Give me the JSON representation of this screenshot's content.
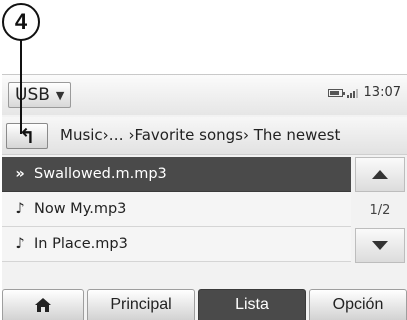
{
  "callout": {
    "label": "4"
  },
  "status_bar": {
    "source": "USB",
    "time": "13:07"
  },
  "breadcrumb": {
    "path": "Music›… ›Favorite songs› The newest"
  },
  "list": {
    "items": [
      {
        "icon": "speaker-icon",
        "label": "Swallowed.m.mp3",
        "active": true
      },
      {
        "icon": "music-note-icon",
        "label": "Now My.mp3",
        "active": false
      },
      {
        "icon": "music-note-icon",
        "label": "In Place.mp3",
        "active": false
      }
    ],
    "page_indicator": "1/2"
  },
  "tabs": {
    "home_icon": "home-icon",
    "principal": "Principal",
    "lista": "Lista",
    "opcion": "Opción"
  },
  "colors": {
    "active_bg": "#4a4a4a",
    "active_text": "#ffffff"
  }
}
